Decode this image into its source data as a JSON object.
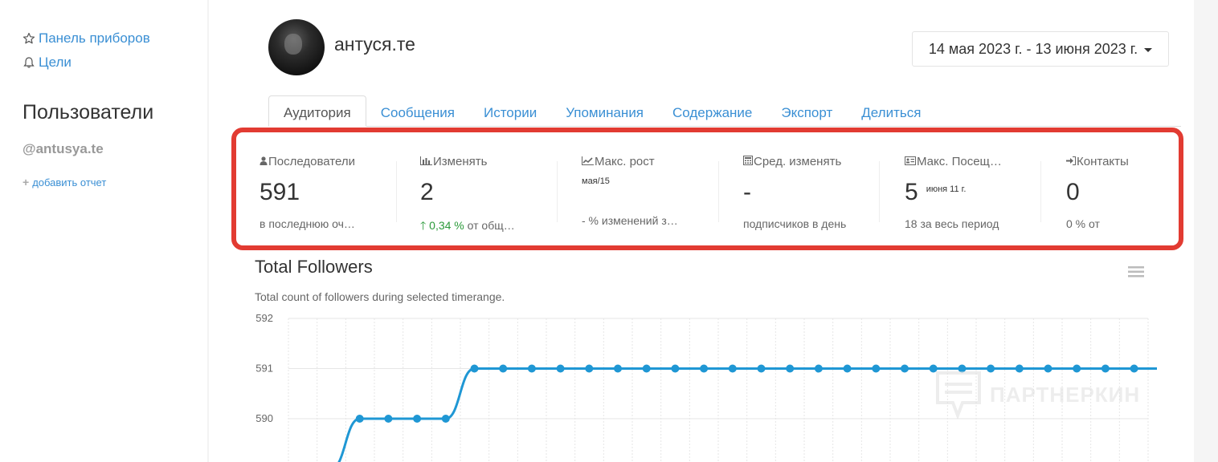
{
  "sidebar": {
    "dashboard_label": "Панель приборов",
    "goals_label": "Цели",
    "users_title": "Пользователи",
    "username": "@antusya.te",
    "add_report_label": "добавить отчет"
  },
  "profile": {
    "name": "антуся.те"
  },
  "date_range": {
    "label": "14 мая 2023 г. - 13 июня 2023 г."
  },
  "tabs": [
    {
      "label": "Аудитория"
    },
    {
      "label": "Сообщения"
    },
    {
      "label": "Истории"
    },
    {
      "label": "Упоминания"
    },
    {
      "label": "Содержание"
    },
    {
      "label": "Экспорт"
    },
    {
      "label": "Делиться"
    }
  ],
  "stats": [
    {
      "label": "Последователи",
      "value": "591",
      "sub": "в последнюю оч…"
    },
    {
      "label": "Изменять",
      "value": "2",
      "sub_green": "0,34 %",
      "sub": "от общ…"
    },
    {
      "label": "Макс. рост",
      "date": "мая/15",
      "sub": "- % изменений з…"
    },
    {
      "label": "Сред. изменять",
      "value": "-",
      "sub": "подписчиков в день"
    },
    {
      "label": "Макс. Посещ…",
      "value": "5",
      "date": "июня 11 г.",
      "sub": "18 за весь период"
    },
    {
      "label": "Контакты",
      "value": "0",
      "sub": "0 % от"
    }
  ],
  "accent_color": "#3a8fd4",
  "highlight_color": "#e23b32",
  "chart_data": {
    "type": "line",
    "title": "Total Followers",
    "subtitle": "Total count of followers during selected timerange.",
    "yticks": [
      "592",
      "591",
      "590"
    ],
    "ylim": [
      589,
      592
    ],
    "series": [
      {
        "values": [
          589,
          590,
          590,
          590,
          590,
          591,
          591,
          591,
          591,
          591,
          591,
          591,
          591,
          591,
          591,
          591,
          591,
          591,
          591,
          591,
          591,
          591,
          591,
          591,
          591,
          591,
          591,
          591,
          591,
          591,
          591
        ]
      }
    ],
    "line_color": "#1f97d4",
    "grid": true
  },
  "watermark": "ПАРТНЕРКИН"
}
